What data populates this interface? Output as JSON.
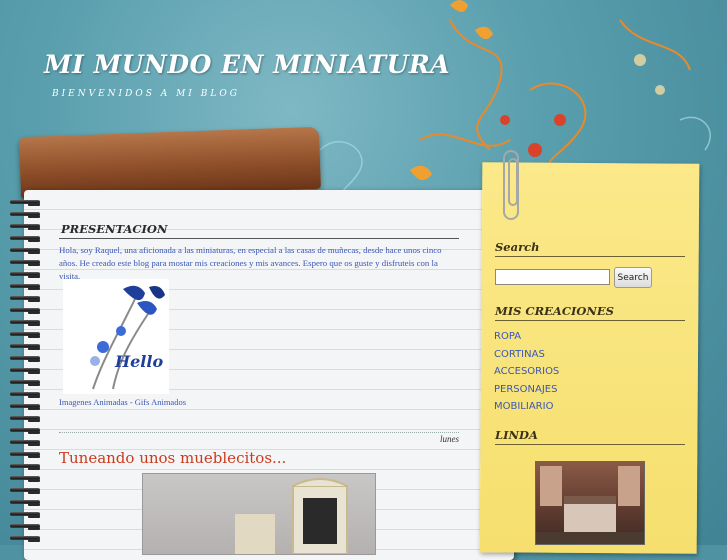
{
  "header": {
    "title": "MI MUNDO EN MINIATURA",
    "description": "BIENVENIDOS A MI BLOG"
  },
  "main": {
    "presentation": {
      "heading": "PRESENTACION",
      "text": "Hola, soy Raquel, una aficionada a las miniaturas, en especial a las casas de muñecas, desde hace unos cinco años. He creado este blog para mostar mis creaciones y mis avances. Espero que os guste y disfruteis con la visita.",
      "image_text": "Hello",
      "image_caption": "Imagenes Animadas - Gifs Animados"
    },
    "date_header": "lunes",
    "post_title": "Tuneando unos mueblecitos..."
  },
  "sidebar": {
    "search_heading": "Search",
    "search_button": "Search",
    "creations_heading": "MIS CREACIONES",
    "links": [
      "ROPA",
      "CORTINAS",
      "ACCESORIOS",
      "PERSONAJES",
      "MOBILIARIO"
    ],
    "linda_heading": "LINDA"
  },
  "colors": {
    "link": "#3a57b5",
    "post_title": "#cc3a1e",
    "sidebar_bg": "#f6df6e",
    "background": "#4f93a3"
  },
  "icons": [
    "flower-ornament-icon",
    "paper-clip-icon",
    "spiral-binding-icon"
  ]
}
